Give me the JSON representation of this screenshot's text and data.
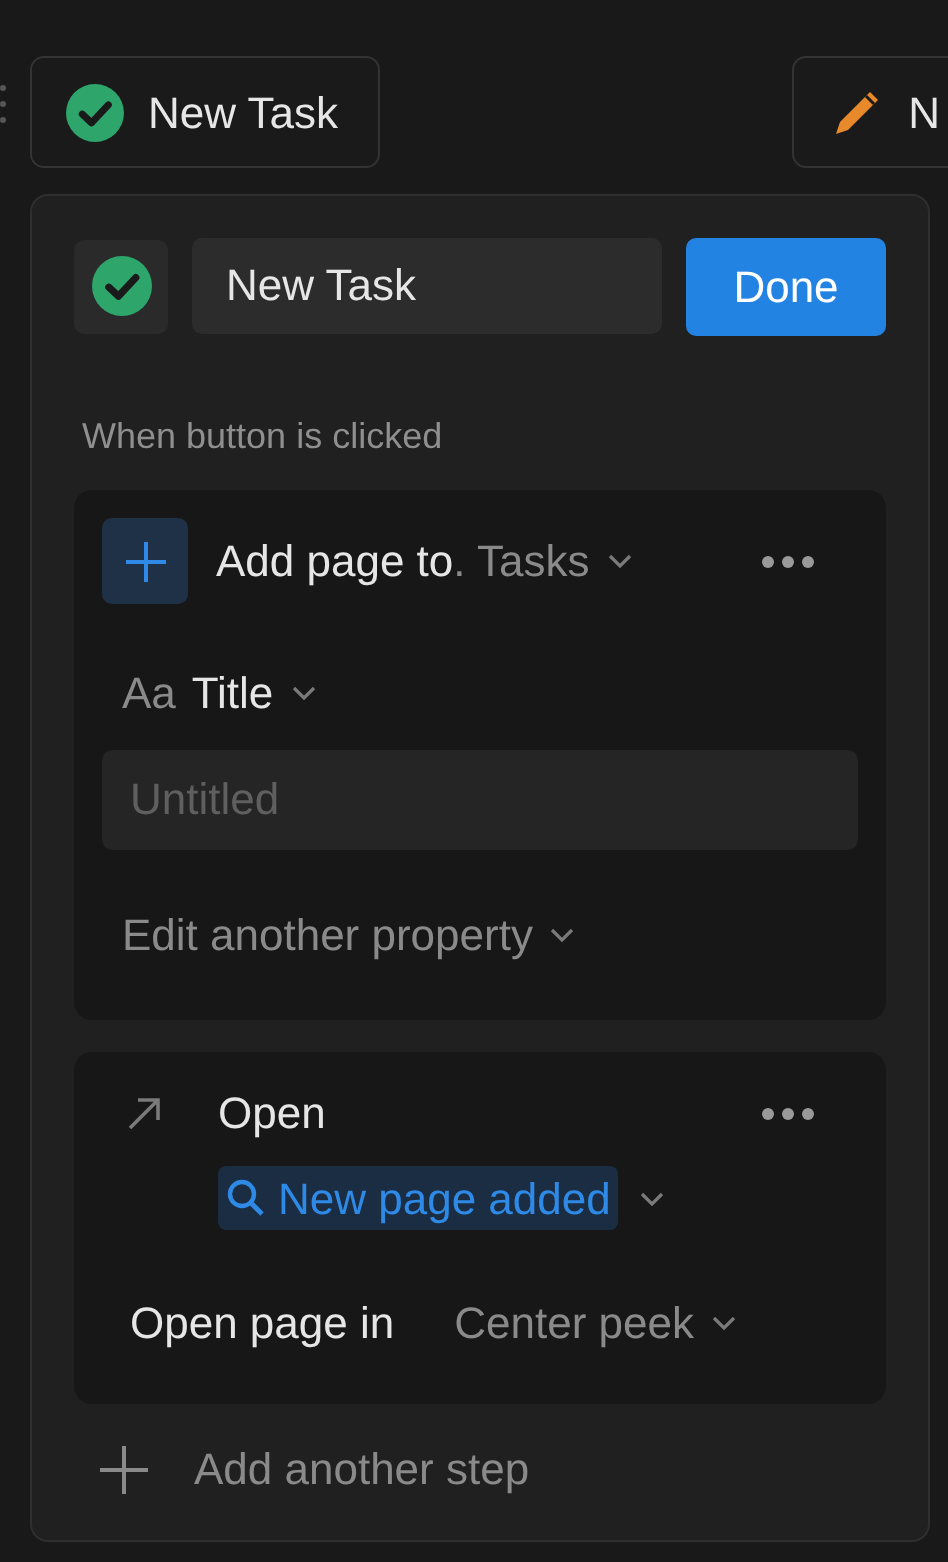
{
  "top_buttons": [
    {
      "kind": "check",
      "label": "New Task"
    },
    {
      "kind": "pencil",
      "label": "N"
    }
  ],
  "editor": {
    "name_value": "New Task",
    "done_label": "Done"
  },
  "trigger_label": "When button is clicked",
  "steps": [
    {
      "kind": "add_page",
      "action": "Add page to",
      "separator": ".",
      "database": "Tasks",
      "property_prefix": "Aa",
      "property_label": "Title",
      "placeholder": "Untitled",
      "edit_another": "Edit another property"
    },
    {
      "kind": "open",
      "action": "Open",
      "target": "New page added",
      "option_label": "Open page in",
      "option_value": "Center peek"
    }
  ],
  "add_step": "Add another step"
}
